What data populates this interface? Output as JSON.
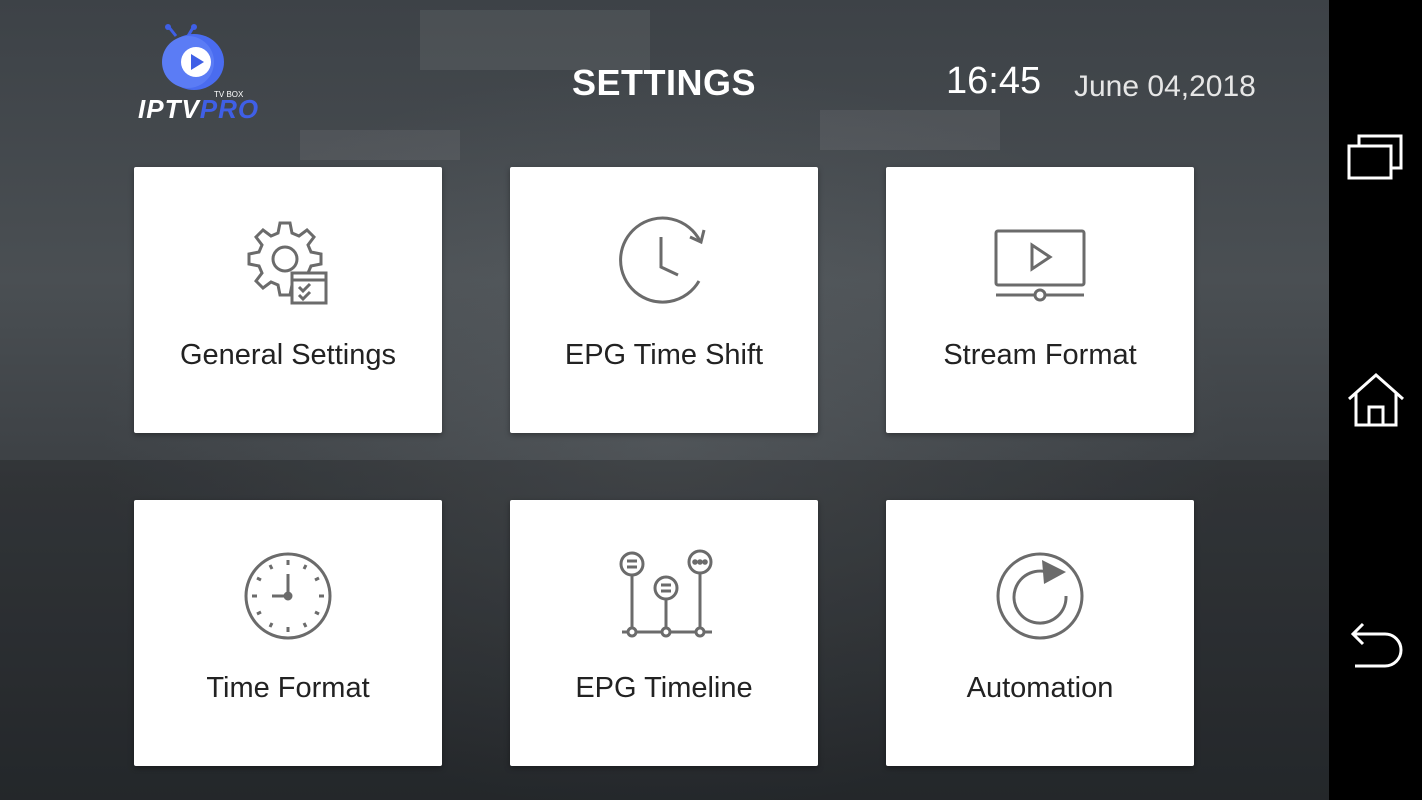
{
  "logo": {
    "brand_main": "IPTV",
    "brand_accent": "PRO",
    "brand_sub": "TV BOX",
    "accent_color": "#3f5fe6"
  },
  "header": {
    "title": "SETTINGS",
    "time": "16:45",
    "date": "June 04,2018"
  },
  "tiles": [
    {
      "label": "General Settings",
      "icon": "gear-icon"
    },
    {
      "label": "EPG Time Shift",
      "icon": "clock-refresh-icon"
    },
    {
      "label": "Stream Format",
      "icon": "video-player-icon"
    },
    {
      "label": "Time Format",
      "icon": "clock-icon"
    },
    {
      "label": "EPG Timeline",
      "icon": "timeline-icon"
    },
    {
      "label": "Automation",
      "icon": "refresh-icon"
    }
  ],
  "navbar": {
    "buttons": [
      "recent-apps-icon",
      "home-icon",
      "back-icon"
    ]
  },
  "colors": {
    "icon_stroke": "#6b6b6b",
    "tile_bg": "#ffffff",
    "nav_bg": "#000000"
  }
}
